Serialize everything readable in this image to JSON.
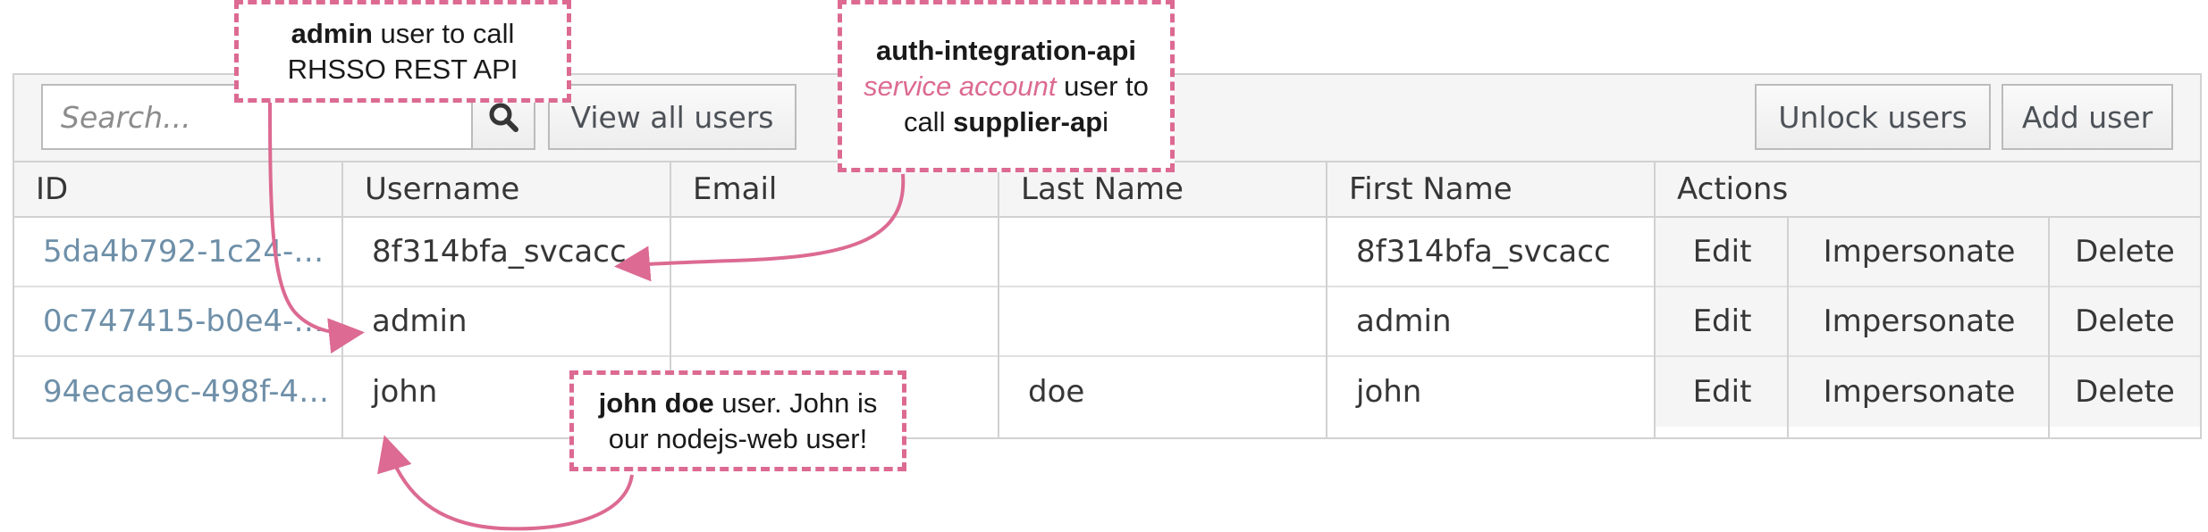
{
  "toolbar": {
    "search_placeholder": "Search...",
    "view_all_label": "View all users",
    "unlock_label": "Unlock users",
    "add_label": "Add user"
  },
  "table": {
    "columns": [
      "ID",
      "Username",
      "Email",
      "Last Name",
      "First Name",
      "Actions"
    ],
    "rows": [
      {
        "id": "5da4b792-1c24-…",
        "username": "8f314bfa_svcacc",
        "email": "",
        "last_name": "",
        "first_name": "8f314bfa_svcacc"
      },
      {
        "id": "0c747415-b0e4-…",
        "username": "admin",
        "email": "",
        "last_name": "",
        "first_name": "admin"
      },
      {
        "id": "94ecae9c-498f-4…",
        "username": "john",
        "email": "",
        "last_name": "doe",
        "first_name": "john"
      }
    ],
    "actions": [
      "Edit",
      "Impersonate",
      "Delete"
    ]
  },
  "callouts": {
    "admin": {
      "bold": "admin",
      "rest_line1": " user to call",
      "line2": "RHSSO REST API"
    },
    "auth": {
      "line1_bold": "auth-integration-api",
      "line2_italic": "service account",
      "line2_rest": " user to",
      "line3_pre": "call ",
      "line3_bold": "supplier-ap",
      "line3_post": "i"
    },
    "john": {
      "bold": "john doe",
      "rest_line1": " user. John is",
      "line2": "our nodejs-web user!"
    }
  },
  "colors": {
    "accent_pink": "#dc6a92",
    "link_blue": "#6e8fa8",
    "border": "#d1d1d1"
  },
  "icons": {
    "search": "search-icon"
  }
}
